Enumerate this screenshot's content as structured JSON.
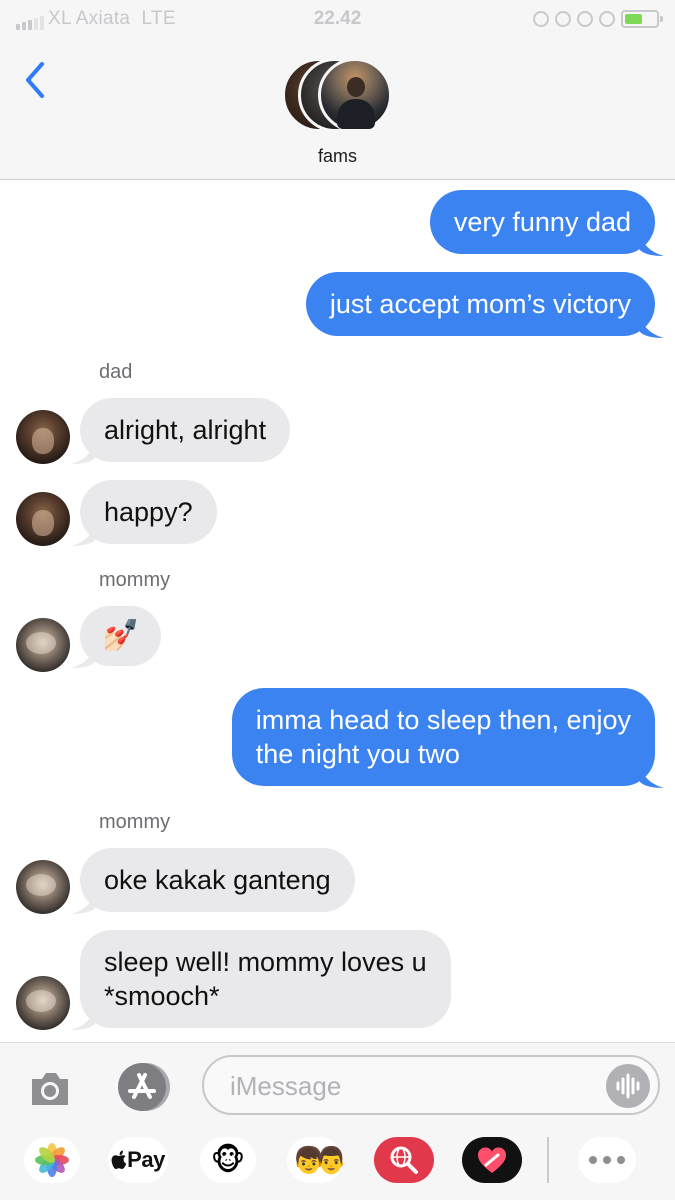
{
  "status_bar": {
    "carrier": "XL Axiata",
    "network": "LTE",
    "time": "22.42"
  },
  "header": {
    "group_name": "fams"
  },
  "messages": [
    {
      "type": "outgoing",
      "text": "very funny dad"
    },
    {
      "type": "outgoing",
      "text": "just accept mom’s victory"
    },
    {
      "type": "sender",
      "text": "dad"
    },
    {
      "type": "incoming",
      "from": "dad",
      "text": "alright, alright"
    },
    {
      "type": "incoming",
      "from": "dad",
      "text": "happy?"
    },
    {
      "type": "sender",
      "text": "mommy"
    },
    {
      "type": "incoming",
      "from": "mommy",
      "text": "💅🏻"
    },
    {
      "type": "outgoing",
      "lines": [
        "imma head to sleep then, enjoy",
        "the night you two"
      ]
    },
    {
      "type": "sender",
      "text": "mommy"
    },
    {
      "type": "incoming",
      "from": "mommy",
      "text": "oke kakak ganteng"
    },
    {
      "type": "incoming",
      "from": "mommy",
      "lines": [
        "sleep well! mommy loves u",
        "*smooch*"
      ]
    }
  ],
  "composer": {
    "placeholder": "iMessage",
    "value": ""
  },
  "app_tray": {
    "apple_pay_label": "Pay",
    "items": [
      "photos-icon",
      "apple-pay-icon",
      "animoji-icon",
      "memoji-icon",
      "web-images-icon",
      "digital-touch-icon",
      "more-icon"
    ]
  },
  "colors": {
    "outgoing_bubble": "#3c83f2",
    "incoming_bubble": "#e9e9eb",
    "ios_blue": "#2f7cf6"
  }
}
